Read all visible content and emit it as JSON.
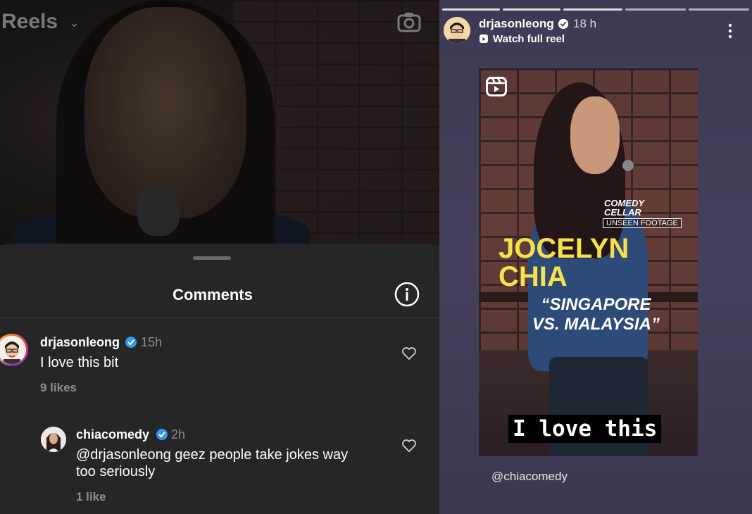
{
  "left_panel": {
    "header": {
      "title": "Reels"
    },
    "comments": {
      "title": "Comments",
      "items": [
        {
          "username": "drjasonleong",
          "time": "15h",
          "text": "I love this bit",
          "likes": "9 likes"
        },
        {
          "username": "chiacomedy",
          "time": "2h",
          "text_line1": "@drjasonleong geez people take jokes way",
          "text_line2": "too seriously",
          "likes": "1 like"
        }
      ]
    }
  },
  "story": {
    "progress_segments": 5,
    "username": "drjasonleong",
    "time": "18 h",
    "watch_label": "Watch full reel",
    "card": {
      "venue_logo_line1": "COMEDY",
      "venue_logo_line2": "CELLAR",
      "badge": "UNSEEN FOOTAGE",
      "name_line1": "JOCELYN",
      "name_line2": "CHIA",
      "quote_line1": "“SINGAPORE",
      "quote_line2": "VS. MALAYSIA”",
      "caption": "I love this"
    },
    "mention": "@chiacomedy"
  },
  "colors": {
    "verified": "#3897f0",
    "name_yellow": "#f7e14b",
    "sheet_bg": "#262626"
  }
}
